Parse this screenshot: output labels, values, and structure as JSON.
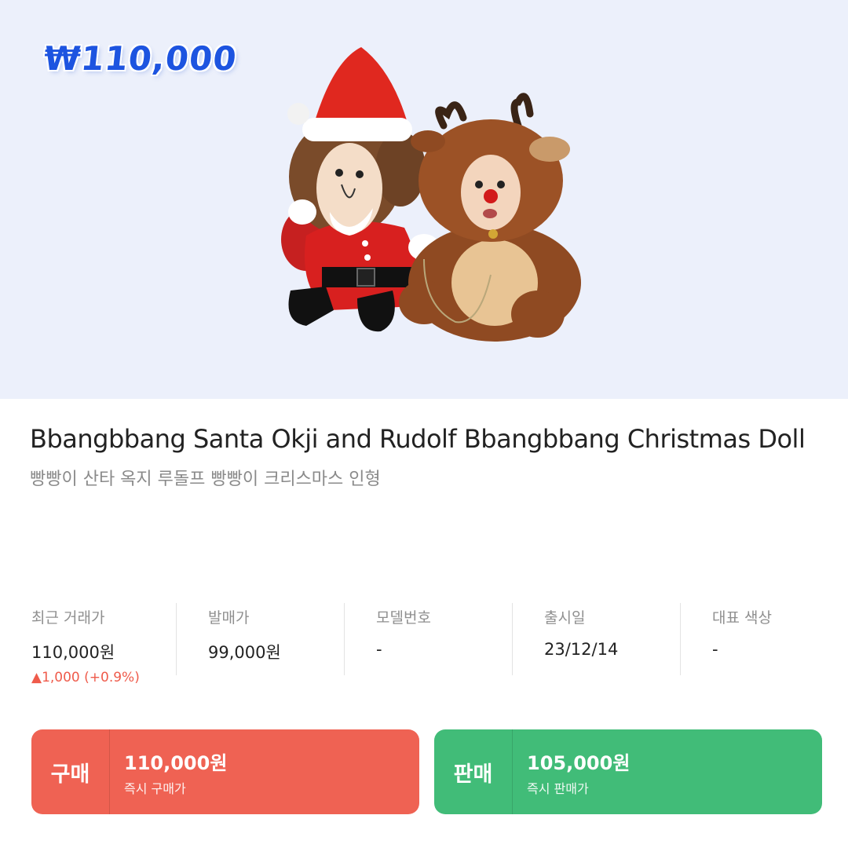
{
  "hero": {
    "price_tag": "₩110,000",
    "image_alt": "Santa Okji and Rudolf plush dolls"
  },
  "product": {
    "title": "Bbangbbang Santa Okji and Rudolf Bbangbbang Christmas Doll",
    "subtitle": "빵빵이 산타 옥지 루돌프 빵빵이 크리스마스 인형"
  },
  "info": [
    {
      "label": "최근 거래가",
      "value": "110,000원",
      "change": "▲1,000 (+0.9%)"
    },
    {
      "label": "발매가",
      "value": "99,000원"
    },
    {
      "label": "모델번호",
      "value": "-"
    },
    {
      "label": "출시일",
      "value": "23/12/14"
    },
    {
      "label": "대표 색상",
      "value": "-"
    }
  ],
  "buy": {
    "kind": "구매",
    "amount": "110,000원",
    "sub": "즉시 구매가",
    "color": "#ef6253"
  },
  "sell": {
    "kind": "판매",
    "amount": "105,000원",
    "sub": "즉시 판매가",
    "color": "#41bc78"
  },
  "colors": {
    "hero_bg": "#ecf0fb",
    "price_tag": "#1d54e0",
    "up": "#ef5b4b"
  }
}
